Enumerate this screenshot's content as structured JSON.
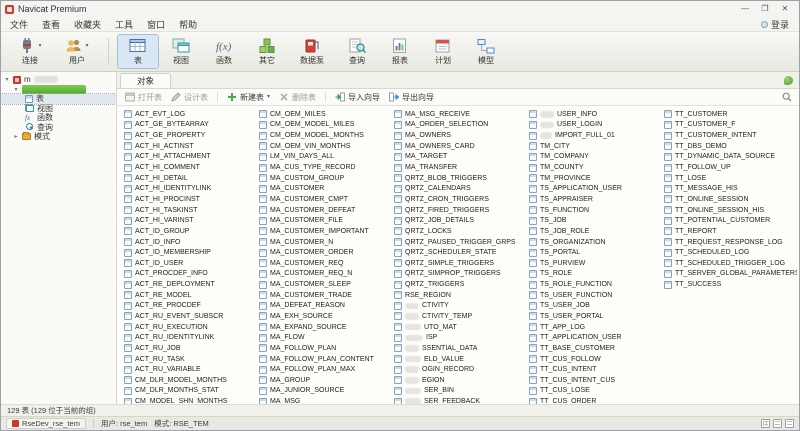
{
  "titlebar": {
    "title": "Navicat Premium",
    "min": "—",
    "max": "❐",
    "close": "✕"
  },
  "menubar": {
    "items": [
      "文件",
      "查看",
      "收藏夹",
      "工具",
      "窗口",
      "帮助"
    ],
    "right": "登录"
  },
  "toolbar": {
    "connect": {
      "label": "连接"
    },
    "user": {
      "label": "用户"
    },
    "buttons": [
      {
        "label": "表"
      },
      {
        "label": "视图"
      },
      {
        "label": "函数"
      },
      {
        "label": "其它"
      },
      {
        "label": "数据泵"
      },
      {
        "label": "查询"
      },
      {
        "label": "报表"
      },
      {
        "label": "计划"
      },
      {
        "label": "模型"
      }
    ]
  },
  "sidebar": {
    "connection_label": "m",
    "items": [
      {
        "label": "表"
      },
      {
        "label": "视图"
      },
      {
        "label": "函数"
      },
      {
        "label": "查询"
      },
      {
        "label": "模式"
      }
    ]
  },
  "content": {
    "tab": "对象",
    "actions": [
      "打开表",
      "设计表",
      "新建表",
      "删除表",
      "导入向导",
      "导出向导"
    ]
  },
  "tables": {
    "columns": [
      [
        "ACT_EVT_LOG",
        "ACT_GE_BYTEARRAY",
        "ACT_GE_PROPERTY",
        "ACT_HI_ACTINST",
        "ACT_HI_ATTACHMENT",
        "ACT_HI_COMMENT",
        "ACT_HI_DETAIL",
        "ACT_HI_IDENTITYLINK",
        "ACT_HI_PROCINST",
        "ACT_HI_TASKINST",
        "ACT_HI_VARINST",
        "ACT_ID_GROUP",
        "ACT_ID_INFO",
        "ACT_ID_MEMBERSHIP",
        "ACT_ID_USER",
        "ACT_PROCDEF_INFO",
        "ACT_RE_DEPLOYMENT",
        "ACT_RE_MODEL",
        "ACT_RE_PROCDEF",
        "ACT_RU_EVENT_SUBSCR",
        "ACT_RU_EXECUTION",
        "ACT_RU_IDENTITYLINK",
        "ACT_RU_JOB",
        "ACT_RU_TASK",
        "ACT_RU_VARIABLE",
        "CM_DLR_MODEL_MONTHS",
        "CM_DLR_MONTHS_STAT",
        "CM_MODEL_SHN_MONTHS"
      ],
      [
        "CM_OEM_MILES",
        "CM_OEM_MODEL_MILES",
        "CM_OEM_MODEL_MONTHS",
        "CM_OEM_VIN_MONTHS",
        "LM_VIN_DAYS_ALL",
        "MA_CUS_TYPE_RECORD",
        "MA_CUSTOM_GROUP",
        "MA_CUSTOMER",
        "MA_CUSTOMER_CMPT",
        "MA_CUSTOMER_DEFEAT",
        "MA_CUSTOMER_FILE",
        "MA_CUSTOMER_IMPORTANT",
        "MA_CUSTOMER_N",
        "MA_CUSTOMER_ORDER",
        "MA_CUSTOMER_REQ",
        "MA_CUSTOMER_REQ_N",
        "MA_CUSTOMER_SLEEP",
        "MA_CUSTOMER_TRADE",
        "MA_DEFEAT_REASON",
        "MA_EXH_SOURCE",
        "MA_EXPAND_SOURCE",
        "MA_FLOW",
        "MA_FOLLOW_PLAN",
        "MA_FOLLOW_PLAN_CONTENT",
        "MA_FOLLOW_PLAN_MAX",
        "MA_GROUP",
        "MA_JUNIOR_SOURCE",
        "MA_MSG"
      ],
      [
        "MA_MSG_RECEIVE",
        "MA_ORDER_SELECTION",
        "MA_OWNERS",
        "MA_OWNERS_CARD",
        "MA_TARGET",
        "MA_TRANSFER",
        "QRTZ_BLOB_TRIGGERS",
        "QRTZ_CALENDARS",
        "QRTZ_CRON_TRIGGERS",
        "QRTZ_FIRED_TRIGGERS",
        "QRTZ_JOB_DETAILS",
        "QRTZ_LOCKS",
        "QRTZ_PAUSED_TRIGGER_GRPS",
        "QRTZ_SCHEDULER_STATE",
        "QRTZ_SIMPLE_TRIGGERS",
        "QRTZ_SIMPROP_TRIGGERS",
        "QRTZ_TRIGGERS",
        "RSE_REGION",
        {
          "mask": 14,
          "text": "CTIVITY"
        },
        {
          "mask": 14,
          "text": "CTIVITY_TEMP"
        },
        {
          "mask": 16,
          "text": "UTO_MAT"
        },
        {
          "mask": 18,
          "text": "ISP"
        },
        {
          "mask": 14,
          "text": "SSENTIAL_DATA"
        },
        {
          "mask": 16,
          "text": "ELD_VALUE"
        },
        {
          "mask": 14,
          "text": "OGIN_RECORD"
        },
        {
          "mask": 14,
          "text": "EGION"
        },
        {
          "mask": 16,
          "text": "SER_BIN"
        },
        {
          "mask": 16,
          "text": "SER_FEEDBACK"
        }
      ],
      [
        {
          "mask": 14,
          "text": "USER_INFO"
        },
        {
          "mask": 14,
          "text": "USER_LOGIN"
        },
        {
          "mask": 12,
          "text": "IMPORT_FULL_01"
        },
        "TM_CITY",
        "TM_COMPANY",
        "TM_COUNTY",
        "TM_PROVINCE",
        "TS_APPLICATION_USER",
        "TS_APPRAISER",
        "TS_FUNCTION",
        "TS_JOB",
        "TS_JOB_ROLE",
        "TS_ORGANIZATION",
        "TS_PORTAL",
        "TS_PURVIEW",
        "TS_ROLE",
        "TS_ROLE_FUNCTION",
        "TS_USER_FUNCTION",
        "TS_USER_JOB",
        "TS_USER_PORTAL",
        "TT_APP_LOG",
        "TT_APPLICATION_USER",
        "TT_BASE_CUSTOMER",
        "TT_CUS_FOLLOW",
        "TT_CUS_INTENT",
        "TT_CUS_INTENT_CUS",
        "TT_CUS_LOSE",
        "TT_CUS_ORDER"
      ],
      [
        "TT_CUSTOMER",
        "TT_CUSTOMER_F",
        "TT_CUSTOMER_INTENT",
        "TT_DBS_DEMO",
        "TT_DYNAMIC_DATA_SOURCE",
        "TT_FOLLOW_UP",
        "TT_LOSE",
        "TT_MESSAGE_HIS",
        "TT_ONLINE_SESSION",
        "TT_ONLINE_SESSION_HIS",
        "TT_POTENTIAL_CUSTOMER",
        "TT_REPORT",
        "TT_REQUEST_RESPONSE_LOG",
        "TT_SCHEDULED_LOG",
        "TT_SCHEDULED_TRIGGER_LOG",
        "TT_SERVER_GLOBAL_PARAMETERS",
        "TT_SUCCESS"
      ]
    ]
  },
  "statusbar": {
    "count_text": "129 表 (129 位于当前的组)",
    "connection": "RseDev_rse_tem",
    "user_text": "用户: rse_tem",
    "schema_text": "模式: RSE_TEM"
  }
}
